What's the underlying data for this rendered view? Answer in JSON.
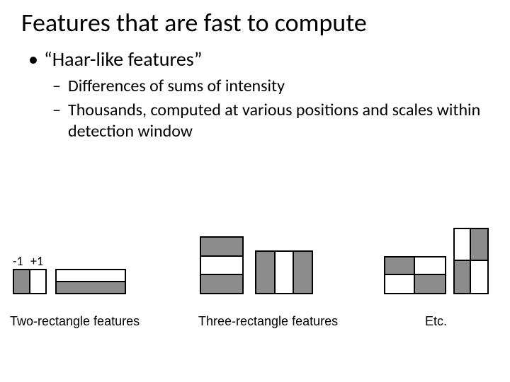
{
  "title": "Features that are fast to compute",
  "bullets": {
    "b1": "“Haar-like features”",
    "b2a": "Differences of sums of intensity",
    "b2b": "Thousands, computed at various positions and scales within detection window"
  },
  "legend": {
    "neg": "-1",
    "pos": "+1"
  },
  "captions": {
    "two": "Two-rectangle features",
    "three": "Three-rectangle features",
    "etc": "Etc."
  }
}
